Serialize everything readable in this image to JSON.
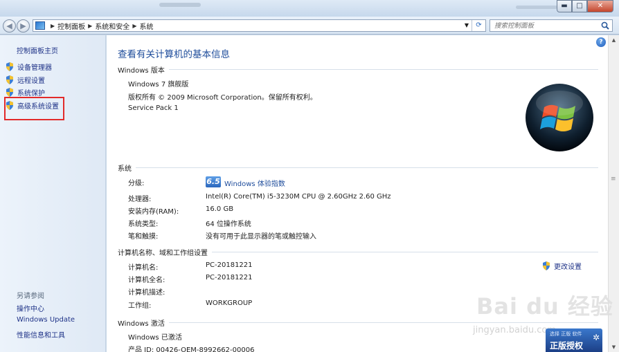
{
  "address": {
    "crumbs": [
      "控制面板",
      "系统和安全",
      "系统"
    ],
    "search_placeholder": "搜索控制面板"
  },
  "sidebar": {
    "home": "控制面板主页",
    "items": [
      {
        "label": "设备管理器"
      },
      {
        "label": "远程设置"
      },
      {
        "label": "系统保护"
      },
      {
        "label": "高级系统设置"
      }
    ],
    "see_also_title": "另请参阅",
    "see_also": [
      "操作中心",
      "Windows Update",
      "性能信息和工具"
    ]
  },
  "main": {
    "title": "查看有关计算机的基本信息",
    "edition": {
      "heading": "Windows 版本",
      "name": "Windows 7 旗舰版",
      "copyright": "版权所有 © 2009 Microsoft Corporation。保留所有权利。",
      "service_pack": "Service Pack 1"
    },
    "system": {
      "heading": "系统",
      "rating_label": "分级:",
      "rating_value": "6.5",
      "rating_link": "Windows 体验指数",
      "rows": [
        {
          "label": "处理器:",
          "value": "Intel(R) Core(TM) i5-3230M CPU @ 2.60GHz   2.60 GHz"
        },
        {
          "label": "安装内存(RAM):",
          "value": "16.0 GB"
        },
        {
          "label": "系统类型:",
          "value": "64 位操作系统"
        },
        {
          "label": "笔和触摸:",
          "value": "没有可用于此显示器的笔或触控输入"
        }
      ]
    },
    "computer": {
      "heading": "计算机名称、域和工作组设置",
      "change_link": "更改设置",
      "rows": [
        {
          "label": "计算机名:",
          "value": "PC-20181221"
        },
        {
          "label": "计算机全名:",
          "value": "PC-20181221"
        },
        {
          "label": "计算机描述:",
          "value": ""
        },
        {
          "label": "工作组:",
          "value": "WORKGROUP"
        }
      ]
    },
    "activation": {
      "heading": "Windows 激活",
      "status": "Windows 已激活",
      "product_id_partial": "产品 ID: 00426-OEM-8992662-00006"
    }
  },
  "overlay": {
    "watermark": "Bai du 经验",
    "watermark_url": "jingyan.baidu.com",
    "genuine_top": "选择 正版 软件",
    "genuine_main": "正版授权"
  },
  "colors": {
    "link": "#1e3287",
    "title": "#1e4c9b",
    "highlight_box": "#e22a2a"
  }
}
